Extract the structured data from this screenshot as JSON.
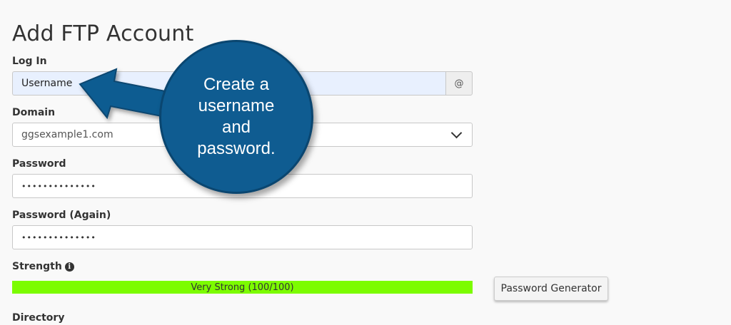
{
  "page": {
    "title": "Add FTP Account"
  },
  "form": {
    "login": {
      "label": "Log In",
      "value": "Username",
      "addon": "@"
    },
    "domain": {
      "label": "Domain",
      "value": "ggsexample1.com"
    },
    "password": {
      "label": "Password",
      "value": "••••••••••••••"
    },
    "password_again": {
      "label": "Password (Again)",
      "value": "••••••••••••••"
    },
    "strength": {
      "label": "Strength",
      "meter_text": "Very Strong (100/100)",
      "percent": 100,
      "color": "#7cfc00"
    },
    "generator_button": "Password Generator",
    "directory": {
      "label": "Directory"
    }
  },
  "callout": {
    "text": "Create a\nusername\nand\npassword.",
    "color": "#0f5c91"
  }
}
